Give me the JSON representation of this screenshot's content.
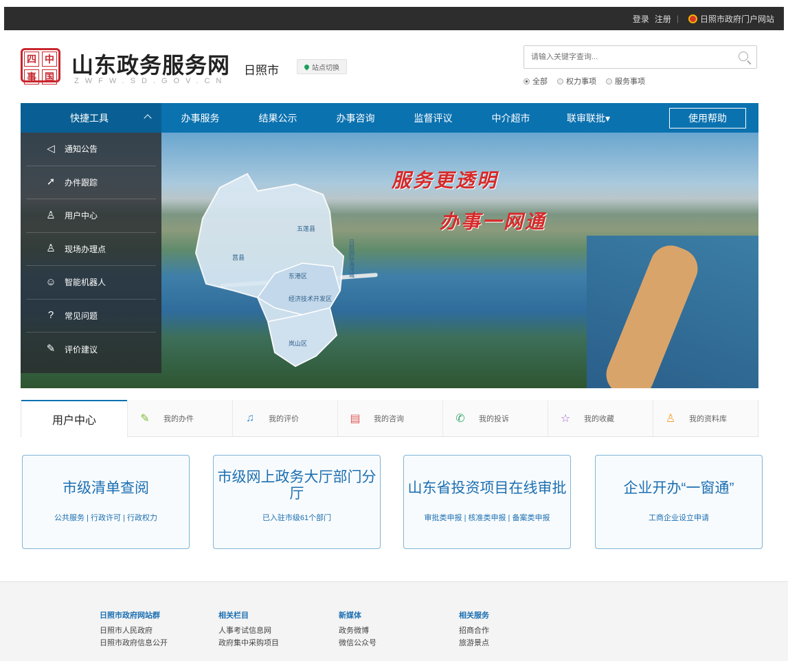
{
  "topbar": {
    "login": "登录",
    "register": "注册",
    "separator": "|",
    "portal": "日照市政府门户网站"
  },
  "header": {
    "logo_chars": [
      "中",
      "四",
      "国",
      "事"
    ],
    "title": "山东政务服务网",
    "subtitle": "ZWFW.SD.GOV.CN",
    "city": "日照市",
    "switch_label": "站点切换"
  },
  "search": {
    "placeholder": "请输入关键字查询...",
    "scopes": [
      "全部",
      "权力事项",
      "服务事项"
    ],
    "selected": "全部"
  },
  "nav": {
    "quick_tools": "快捷工具",
    "items": [
      "办事服务",
      "结果公示",
      "办事咨询",
      "监督评议",
      "中介超市",
      "联审联批"
    ],
    "dropdown_marker": "▾",
    "help": "使用帮助"
  },
  "side_menu": [
    {
      "label": "通知公告",
      "icon": "speaker-icon"
    },
    {
      "label": "办件跟踪",
      "icon": "send-icon"
    },
    {
      "label": "用户中心",
      "icon": "user-icon"
    },
    {
      "label": "现场办理点",
      "icon": "location-user-icon"
    },
    {
      "label": "智能机器人",
      "icon": "robot-icon"
    },
    {
      "label": "常见问题",
      "icon": "question-icon"
    },
    {
      "label": "评价建议",
      "icon": "edit-icon"
    }
  ],
  "banner": {
    "slogan_1": "服务更透明",
    "slogan_2": "办事一网通",
    "map_labels": [
      "莒县",
      "五莲县",
      "东港区",
      "经济技术开发区",
      "岚山区",
      "日照国际海洋城"
    ]
  },
  "user_center": {
    "title": "用户中心",
    "tabs": [
      {
        "label": "我的办件",
        "icon": "pencil-icon",
        "color": "#7dbb3c"
      },
      {
        "label": "我的评价",
        "icon": "bell-icon",
        "color": "#3a8fd6"
      },
      {
        "label": "我的咨询",
        "icon": "message-icon",
        "color": "#e25a5a"
      },
      {
        "label": "我的投诉",
        "icon": "phone-icon",
        "color": "#3aa76d"
      },
      {
        "label": "我的收藏",
        "icon": "star-icon",
        "color": "#a35bd1"
      },
      {
        "label": "我的资料库",
        "icon": "profile-icon",
        "color": "#f0a22a"
      }
    ]
  },
  "cards": [
    {
      "title": "市级清单查阅",
      "sub": "公共服务 | 行政许可 | 行政权力"
    },
    {
      "title": "市级网上政务大厅部门分厅",
      "sub": "已入驻市级61个部门"
    },
    {
      "title": "山东省投资项目在线审批",
      "sub": "审批类申报 | 核准类申报 | 备案类申报"
    },
    {
      "title": "企业开办“一窗通”",
      "sub": "工商企业设立申请"
    }
  ],
  "footer": {
    "columns": [
      {
        "heading": "日照市政府网站群",
        "links": [
          "日照市人民政府",
          "日照市政府信息公开"
        ]
      },
      {
        "heading": "相关栏目",
        "links": [
          "人事考试信息网",
          "政府集中采购项目"
        ]
      },
      {
        "heading": "新媒体",
        "links": [
          "政务微博",
          "微信公众号"
        ]
      },
      {
        "heading": "相关服务",
        "links": [
          "招商合作",
          "旅游景点"
        ]
      }
    ]
  },
  "colors": {
    "primary": "#0b72b0",
    "accent_red": "#d62a2a",
    "card_border": "#7eb3d8"
  }
}
